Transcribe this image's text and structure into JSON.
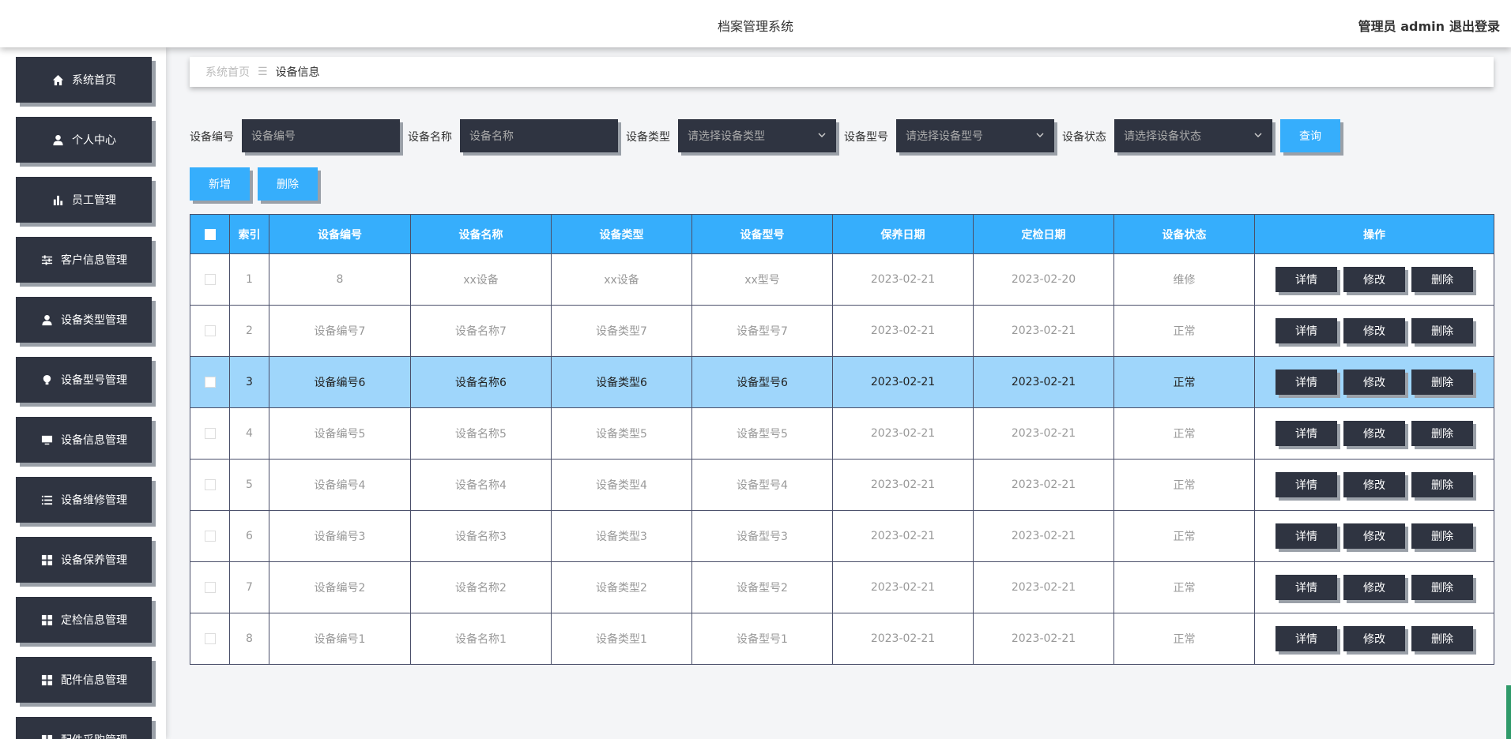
{
  "header": {
    "title": "档案管理系统",
    "user": "管理员 admin",
    "logout": "退出登录"
  },
  "sidebar": {
    "items": [
      {
        "label": "系统首页",
        "icon": "home-icon"
      },
      {
        "label": "个人中心",
        "icon": "user-icon"
      },
      {
        "label": "员工管理",
        "icon": "bar-chart-icon"
      },
      {
        "label": "客户信息管理",
        "icon": "sliders-icon"
      },
      {
        "label": "设备类型管理",
        "icon": "user-tie-icon"
      },
      {
        "label": "设备型号管理",
        "icon": "bulb-icon"
      },
      {
        "label": "设备信息管理",
        "icon": "monitor-icon"
      },
      {
        "label": "设备维修管理",
        "icon": "list-icon"
      },
      {
        "label": "设备保养管理",
        "icon": "grid-icon"
      },
      {
        "label": "定检信息管理",
        "icon": "grid-icon"
      },
      {
        "label": "配件信息管理",
        "icon": "grid-icon"
      },
      {
        "label": "配件采购管理",
        "icon": "grid-icon"
      }
    ]
  },
  "breadcrumb": {
    "home": "系统首页",
    "sep": "☰",
    "current": "设备信息"
  },
  "filters": {
    "code_label": "设备编号",
    "code_placeholder": "设备编号",
    "name_label": "设备名称",
    "name_placeholder": "设备名称",
    "type_label": "设备类型",
    "type_placeholder": "请选择设备类型",
    "model_label": "设备型号",
    "model_placeholder": "请选择设备型号",
    "status_label": "设备状态",
    "status_placeholder": "请选择设备状态",
    "query": "查询"
  },
  "actions": {
    "add": "新增",
    "delete": "删除"
  },
  "table": {
    "headers": [
      "索引",
      "设备编号",
      "设备名称",
      "设备类型",
      "设备型号",
      "保养日期",
      "定检日期",
      "设备状态",
      "操作"
    ],
    "op_labels": {
      "detail": "详情",
      "edit": "修改",
      "delete": "删除"
    },
    "rows": [
      {
        "index": "1",
        "code": "8",
        "name": "xx设备",
        "type": "xx设备",
        "model": "xx型号",
        "maint": "2023-02-21",
        "insp": "2023-02-20",
        "status": "维修"
      },
      {
        "index": "2",
        "code": "设备编号7",
        "name": "设备名称7",
        "type": "设备类型7",
        "model": "设备型号7",
        "maint": "2023-02-21",
        "insp": "2023-02-21",
        "status": "正常"
      },
      {
        "index": "3",
        "code": "设备编号6",
        "name": "设备名称6",
        "type": "设备类型6",
        "model": "设备型号6",
        "maint": "2023-02-21",
        "insp": "2023-02-21",
        "status": "正常"
      },
      {
        "index": "4",
        "code": "设备编号5",
        "name": "设备名称5",
        "type": "设备类型5",
        "model": "设备型号5",
        "maint": "2023-02-21",
        "insp": "2023-02-21",
        "status": "正常"
      },
      {
        "index": "5",
        "code": "设备编号4",
        "name": "设备名称4",
        "type": "设备类型4",
        "model": "设备型号4",
        "maint": "2023-02-21",
        "insp": "2023-02-21",
        "status": "正常"
      },
      {
        "index": "6",
        "code": "设备编号3",
        "name": "设备名称3",
        "type": "设备类型3",
        "model": "设备型号3",
        "maint": "2023-02-21",
        "insp": "2023-02-21",
        "status": "正常"
      },
      {
        "index": "7",
        "code": "设备编号2",
        "name": "设备名称2",
        "type": "设备类型2",
        "model": "设备型号2",
        "maint": "2023-02-21",
        "insp": "2023-02-21",
        "status": "正常"
      },
      {
        "index": "8",
        "code": "设备编号1",
        "name": "设备名称1",
        "type": "设备类型1",
        "model": "设备型号1",
        "maint": "2023-02-21",
        "insp": "2023-02-21",
        "status": "正常"
      }
    ]
  },
  "colors": {
    "primary": "#36aefc",
    "dark": "#2f3441",
    "highlight_row": "#9fd6fb"
  }
}
